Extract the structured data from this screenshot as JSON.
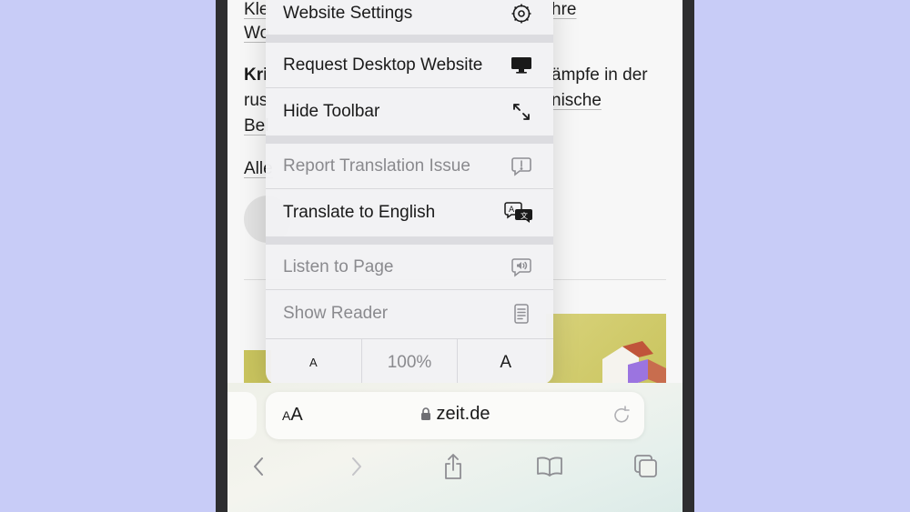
{
  "article": {
    "line1a": "Kle",
    "line1b": "hre",
    "line2": "Wo",
    "line3a": "Kri",
    "line3b": "ämpfe in der",
    "line4a": "rus",
    "line4b": "nische",
    "line5": "Bel",
    "line6": "Alle"
  },
  "menu": {
    "items": [
      {
        "label": "Website Settings",
        "icon": "gear-icon",
        "disabled": false
      },
      {
        "label": "Request Desktop Website",
        "icon": "desktop-icon",
        "disabled": false
      },
      {
        "label": "Hide Toolbar",
        "icon": "expand-arrows-icon",
        "disabled": false
      },
      {
        "label": "Report Translation Issue",
        "icon": "exclamation-bubble-icon",
        "disabled": true
      },
      {
        "label": "Translate to English",
        "icon": "translate-icon",
        "disabled": false
      },
      {
        "label": "Listen to Page",
        "icon": "speaker-bubble-icon",
        "disabled": true
      },
      {
        "label": "Show Reader",
        "icon": "reader-icon",
        "disabled": true
      }
    ],
    "font_small": "A",
    "zoom": "100%",
    "font_large": "A"
  },
  "address_bar": {
    "aa_small": "A",
    "aa_big": "A",
    "url": "zeit.de"
  },
  "colors": {
    "background": "#c8ccf7",
    "menu_bg": "#f2f2f4",
    "disabled_text": "#8a8a8e",
    "icon_gray": "#8e8e93"
  }
}
